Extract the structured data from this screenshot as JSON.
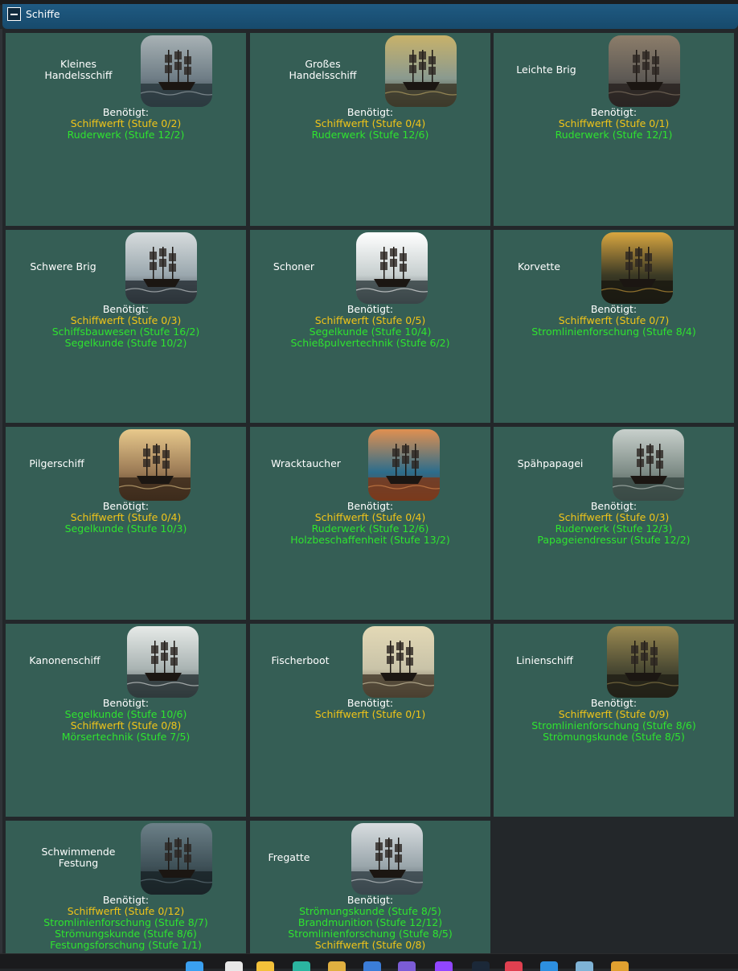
{
  "header": {
    "title": "Schiffe",
    "toggle_icon": "minus-square-icon"
  },
  "colors": {
    "card_bg": "#355e55",
    "background": "#23272a",
    "header_bg": "#1f5a82",
    "met": "#2fe32f",
    "unmet": "#f0c419",
    "text": "#ffffff"
  },
  "required_label": "Benötigt:",
  "ships": [
    {
      "name": "Kleines\nHandelsschiff",
      "image": "small-merchant-ship-image",
      "requirements": [
        {
          "text": "Schiffwerft (Stufe 0/2)",
          "met": false
        },
        {
          "text": "Ruderwerk (Stufe 12/2)",
          "met": true
        }
      ]
    },
    {
      "name": "Großes\nHandelsschiff",
      "image": "large-merchant-ship-image",
      "requirements": [
        {
          "text": "Schiffwerft (Stufe 0/4)",
          "met": false
        },
        {
          "text": "Ruderwerk (Stufe 12/6)",
          "met": true
        }
      ]
    },
    {
      "name": "Leichte Brig",
      "image": "light-brig-image",
      "requirements": [
        {
          "text": "Schiffwerft (Stufe 0/1)",
          "met": false
        },
        {
          "text": "Ruderwerk (Stufe 12/1)",
          "met": true
        }
      ]
    },
    {
      "name": "Schwere Brig",
      "image": "heavy-brig-image",
      "requirements": [
        {
          "text": "Schiffwerft (Stufe 0/3)",
          "met": false
        },
        {
          "text": "Schiffsbauwesen (Stufe 16/2)",
          "met": true
        },
        {
          "text": "Segelkunde (Stufe 10/2)",
          "met": true
        }
      ]
    },
    {
      "name": "Schoner",
      "image": "schooner-image",
      "requirements": [
        {
          "text": "Schiffwerft (Stufe 0/5)",
          "met": false
        },
        {
          "text": "Segelkunde (Stufe 10/4)",
          "met": true
        },
        {
          "text": "Schießpulvertechnik (Stufe 6/2)",
          "met": true
        }
      ]
    },
    {
      "name": "Korvette",
      "image": "corvette-image",
      "requirements": [
        {
          "text": "Schiffwerft (Stufe 0/7)",
          "met": false
        },
        {
          "text": "Stromlinienforschung (Stufe 8/4)",
          "met": true
        }
      ]
    },
    {
      "name": "Pilgerschiff",
      "image": "pilgrim-ship-image",
      "requirements": [
        {
          "text": "Schiffwerft (Stufe 0/4)",
          "met": false
        },
        {
          "text": "Segelkunde (Stufe 10/3)",
          "met": true
        }
      ]
    },
    {
      "name": "Wracktaucher",
      "image": "wreck-diver-image",
      "requirements": [
        {
          "text": "Schiffwerft (Stufe 0/4)",
          "met": false
        },
        {
          "text": "Ruderwerk (Stufe 12/6)",
          "met": true
        },
        {
          "text": "Holzbeschaffenheit (Stufe 13/2)",
          "met": true
        }
      ]
    },
    {
      "name": "Spähpapagei",
      "image": "scout-parrot-image",
      "requirements": [
        {
          "text": "Schiffwerft (Stufe 0/3)",
          "met": false
        },
        {
          "text": "Ruderwerk (Stufe 12/3)",
          "met": true
        },
        {
          "text": "Papageiendressur (Stufe 12/2)",
          "met": true
        }
      ]
    },
    {
      "name": "Kanonenschiff",
      "image": "gunship-image",
      "requirements": [
        {
          "text": "Segelkunde (Stufe 10/6)",
          "met": true
        },
        {
          "text": "Schiffwerft (Stufe 0/8)",
          "met": false
        },
        {
          "text": "Mörsertechnik (Stufe 7/5)",
          "met": true
        }
      ]
    },
    {
      "name": "Fischerboot",
      "image": "fishing-boat-image",
      "requirements": [
        {
          "text": "Schiffwerft (Stufe 0/1)",
          "met": false
        }
      ]
    },
    {
      "name": "Linienschiff",
      "image": "ship-of-the-line-image",
      "requirements": [
        {
          "text": "Schiffwerft (Stufe 0/9)",
          "met": false
        },
        {
          "text": "Stromlinienforschung (Stufe 8/6)",
          "met": true
        },
        {
          "text": "Strömungskunde (Stufe 8/5)",
          "met": true
        }
      ]
    },
    {
      "name": "Schwimmende\nFestung",
      "image": "floating-fortress-image",
      "requirements": [
        {
          "text": "Schiffwerft (Stufe 0/12)",
          "met": false
        },
        {
          "text": "Stromlinienforschung (Stufe 8/7)",
          "met": true
        },
        {
          "text": "Strömungskunde (Stufe 8/6)",
          "met": true
        },
        {
          "text": "Festungsforschung (Stufe 1/1)",
          "met": true
        }
      ]
    },
    {
      "name": "Fregatte",
      "image": "frigate-image",
      "requirements": [
        {
          "text": "Strömungskunde (Stufe 8/5)",
          "met": true
        },
        {
          "text": "Brandmunition (Stufe 12/12)",
          "met": true
        },
        {
          "text": "Stromlinienforschung (Stufe 8/5)",
          "met": true
        },
        {
          "text": "Schiffwerft (Stufe 0/8)",
          "met": false
        }
      ]
    }
  ],
  "taskbar": {
    "icons": [
      "windows-start-icon",
      "notepad-icon",
      "file-explorer-icon",
      "edge-icon",
      "game-app-icon",
      "keepass-icon",
      "messenger-icon",
      "podcast-icon",
      "steam-icon",
      "chat-icon",
      "vscode-icon",
      "monitor-icon",
      "folder-app-icon"
    ]
  }
}
